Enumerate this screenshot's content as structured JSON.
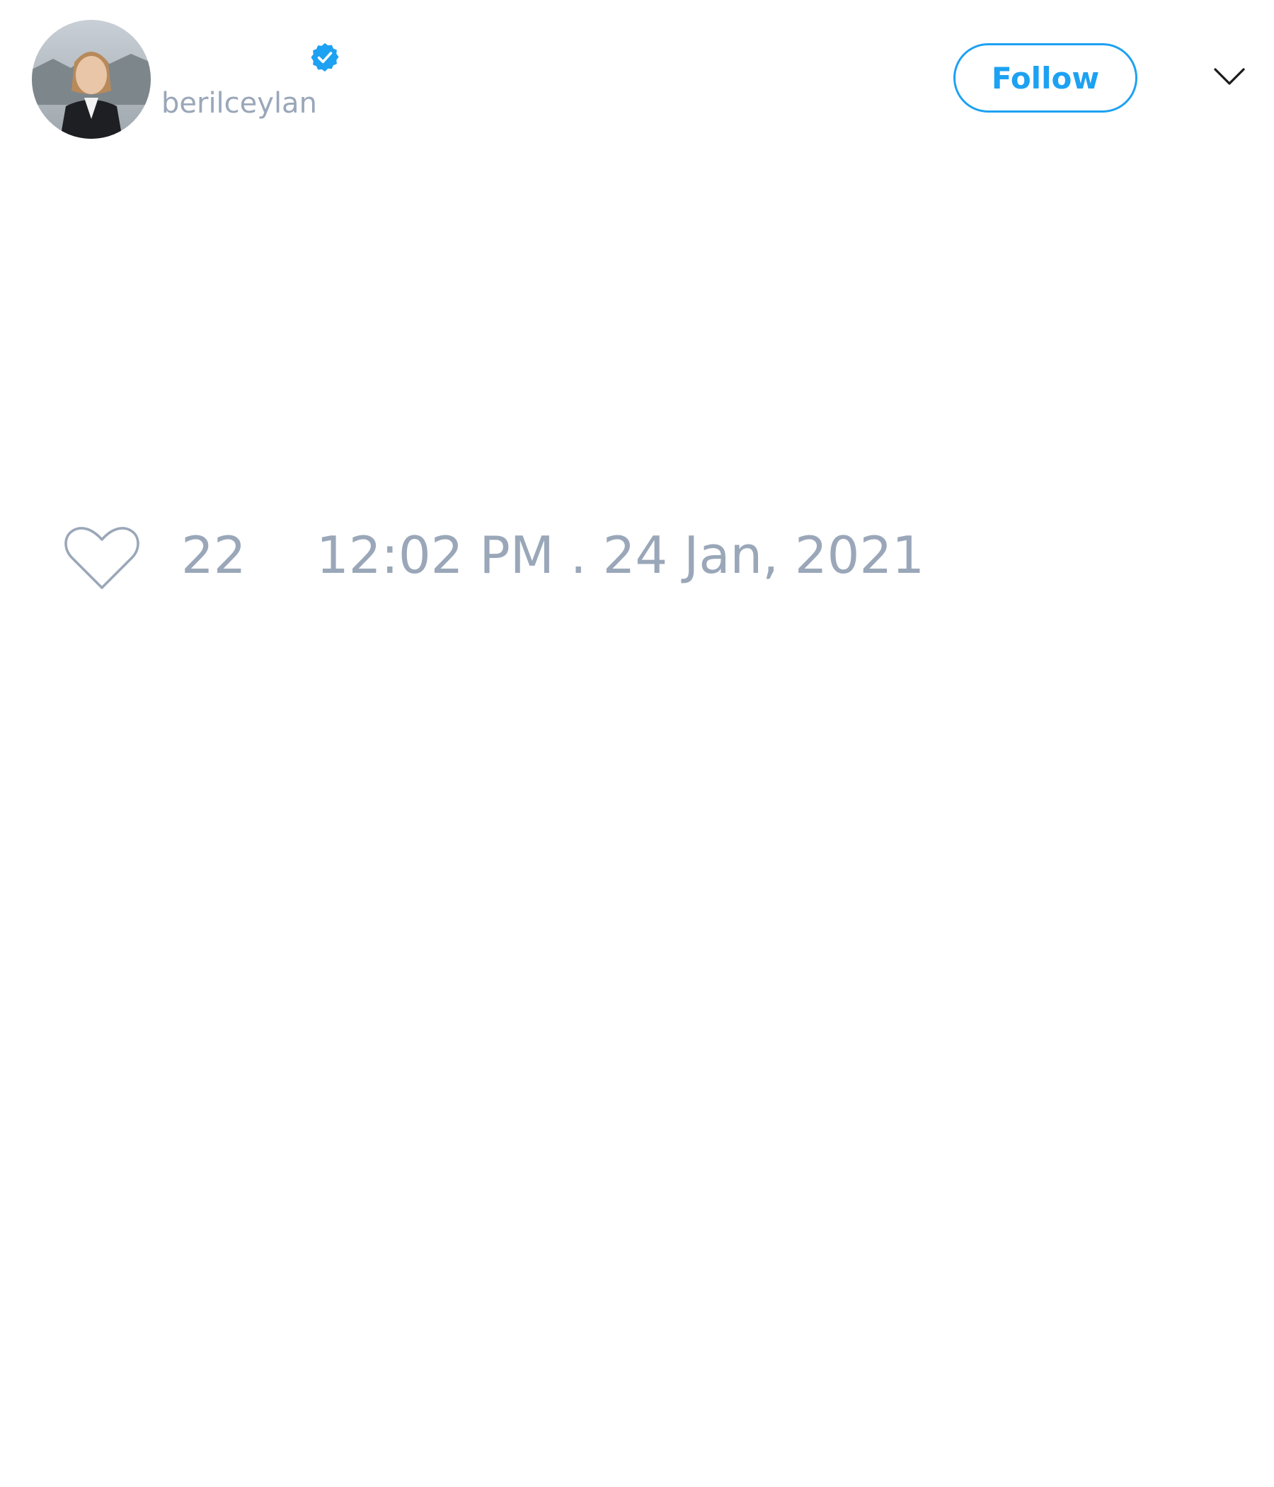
{
  "author": {
    "handle": "berilceylan",
    "verified": true,
    "avatar_icon": "profile-photo"
  },
  "header": {
    "follow_label": "Follow",
    "menu_icon": "chevron-down-icon"
  },
  "tweet": {
    "like_icon": "heart-outline-icon",
    "like_count": "22",
    "timestamp": "12:02 PM . 24 Jan, 2021"
  },
  "colors": {
    "accent": "#1da1f2",
    "muted_text": "#9aa7b9",
    "background": "#ffffff"
  }
}
